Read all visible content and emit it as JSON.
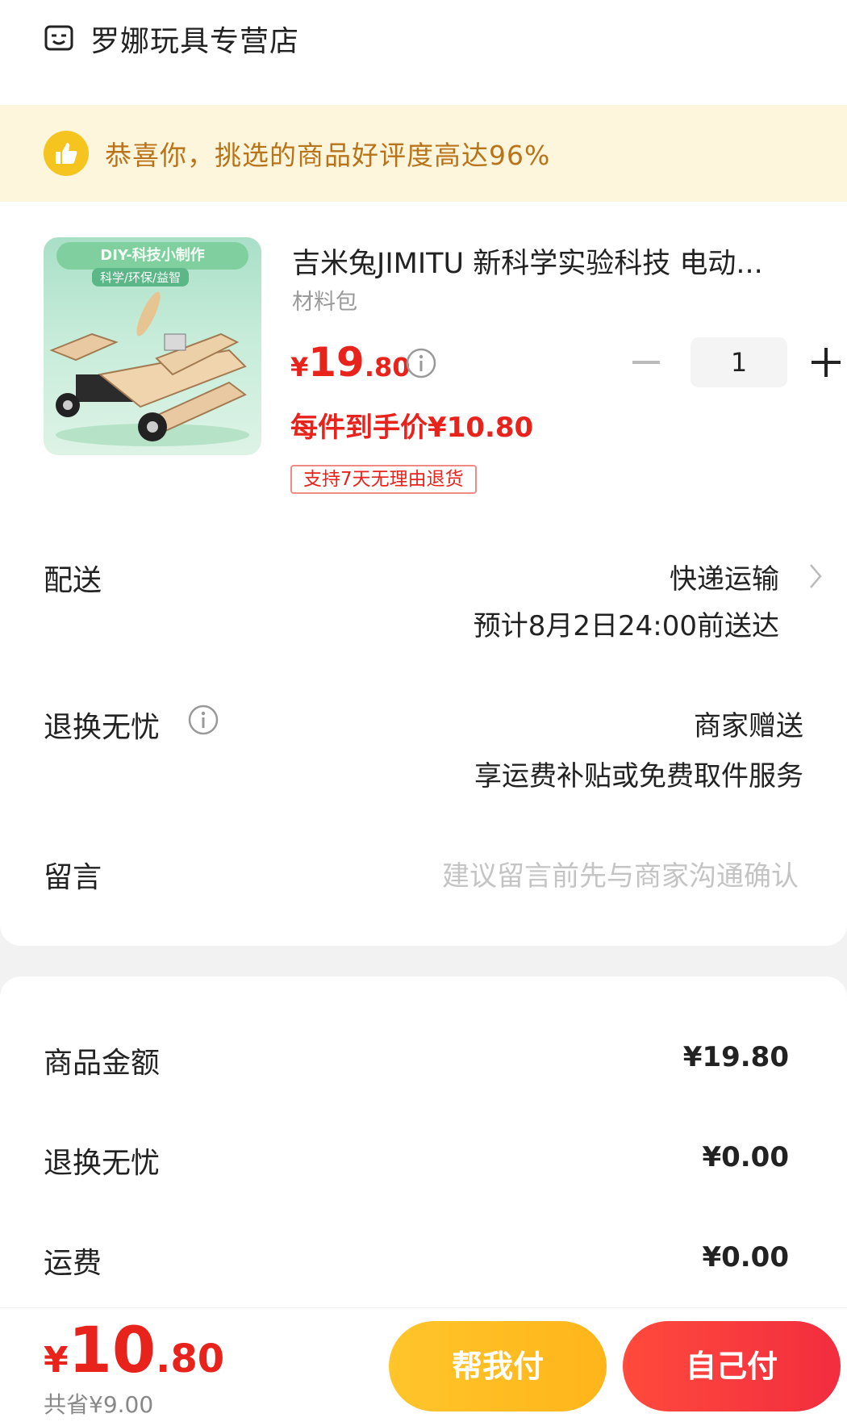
{
  "shop": {
    "name": "罗娜玩具专营店",
    "icon": "store-icon"
  },
  "banner": {
    "text": "恭喜你，挑选的商品好评度高达96%",
    "icon": "thumbs-up-icon",
    "accent": "#f5c41e"
  },
  "product": {
    "image_banner": "DIY-科技小制作",
    "image_sub": "科学/环保/益智",
    "title": "吉米兔JIMITU  新科学实验科技 电动...",
    "subtitle": "材料包",
    "price_yen": "¥",
    "price_int": "19",
    "price_dec": ".80",
    "per_item_price": "每件到手价¥10.80",
    "return_tag": "支持7天无理由退货",
    "quantity": "1"
  },
  "delivery": {
    "label": "配送",
    "method": "快递运输",
    "estimate": "预计8月2日24:00前送达"
  },
  "return_worry_free": {
    "label": "退换无忧",
    "value": "商家赠送",
    "desc": "享运费补贴或免费取件服务"
  },
  "message": {
    "label": "留言",
    "placeholder": "建议留言前先与商家沟通确认"
  },
  "summary": {
    "items": [
      {
        "label": "商品金额",
        "value": "¥19.80"
      },
      {
        "label": "退换无忧",
        "value": "¥0.00"
      },
      {
        "label": "运费",
        "value": "¥0.00"
      }
    ]
  },
  "footer": {
    "total_yen": "¥",
    "total_int": "10",
    "total_dec": ".80",
    "saved": "共省¥9.00",
    "help_pay_label": "帮我付",
    "self_pay_label": "自己付"
  },
  "colors": {
    "price_red": "#e8231c",
    "banner_bg": "#fdf5dc",
    "banner_text": "#b9741a",
    "help_btn": "#ffc52b",
    "self_btn": "#f22d3f"
  }
}
